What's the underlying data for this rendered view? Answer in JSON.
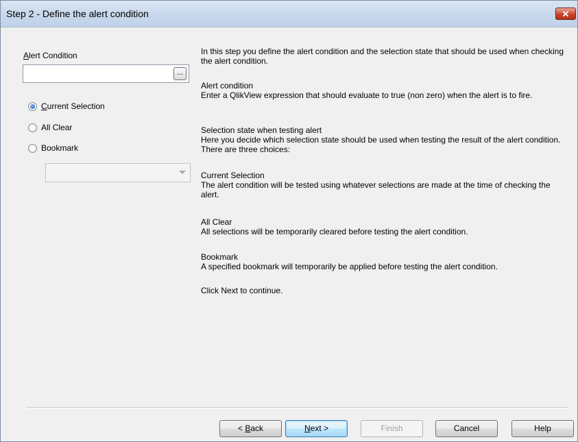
{
  "window": {
    "title": "Step 2 - Define the alert condition",
    "close_glyph": "✕"
  },
  "left": {
    "alert_condition_label_mnemonic": "A",
    "alert_condition_label_rest": "lert Condition",
    "alert_condition_value": "",
    "ellipsis_label": "...",
    "radios": [
      {
        "mnemonic": "C",
        "rest": "urrent Selection",
        "checked": true
      },
      {
        "mnemonic": "",
        "rest": "All Clear",
        "checked": false
      },
      {
        "mnemonic": "",
        "rest": "Bookmark",
        "checked": false
      }
    ],
    "bookmark_value": ""
  },
  "help": {
    "intro": "In this step you define the alert condition and the selection state that should be used when checking the alert condition.",
    "alert_condition_heading": "Alert condition",
    "alert_condition_body": "Enter a QlikView expression that should evaluate to true (non zero) when the alert is to fire.",
    "selection_state_heading": "Selection state when testing alert",
    "selection_state_body": "Here you decide which selection state should be used when testing the result of the alert condition. There are three choices:",
    "current_heading": "Current Selection",
    "current_body": "The alert condition will be tested using whatever selections are made at the time of checking the alert.",
    "allclear_heading": "All Clear",
    "allclear_body": "All selections will be temporarily cleared before testing the alert condition.",
    "bookmark_heading": "Bookmark",
    "bookmark_body": "A specified bookmark will temporarily be applied before testing the alert condition.",
    "footer": "Click Next to continue."
  },
  "buttons": {
    "back_prefix": "< ",
    "back_mnemonic": "B",
    "back_rest": "ack",
    "next_mnemonic": "N",
    "next_rest": "ext >",
    "finish": "Finish",
    "cancel": "Cancel",
    "help": "Help"
  }
}
